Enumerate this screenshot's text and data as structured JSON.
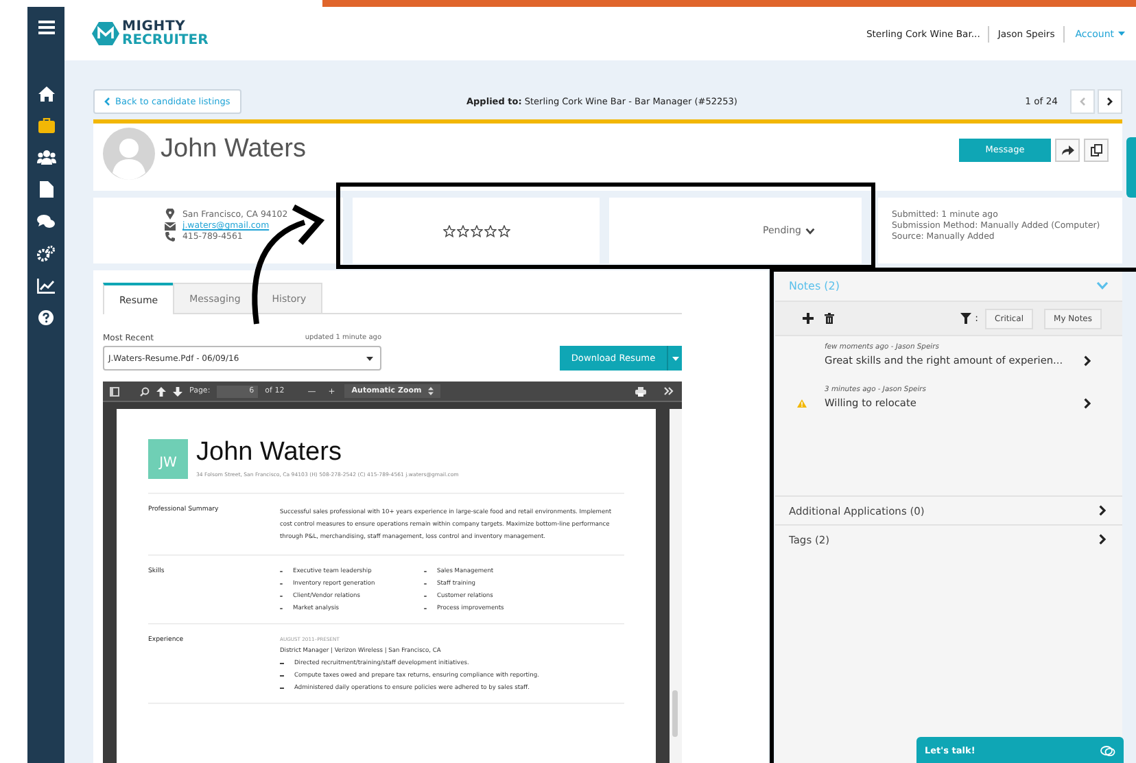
{
  "header": {
    "logo_top": "MIGHTY",
    "logo_bottom": "RECRUITER",
    "company": "Sterling Cork Wine Bar...",
    "user": "Jason Speirs",
    "account": "Account"
  },
  "sidebar": {
    "items": [
      {
        "kind": "home",
        "selected": false
      },
      {
        "kind": "briefcase",
        "selected": true
      },
      {
        "kind": "people",
        "selected": false
      },
      {
        "kind": "document",
        "selected": false
      },
      {
        "kind": "chat",
        "selected": false
      },
      {
        "kind": "settings",
        "selected": false
      },
      {
        "kind": "chart",
        "selected": false
      },
      {
        "kind": "help",
        "selected": false
      }
    ]
  },
  "nav": {
    "back": "Back to candidate listings",
    "applied_label": "Applied to:",
    "applied_value": "Sterling Cork Wine Bar - Bar Manager (#52253)",
    "position": "1 of 24"
  },
  "candidate": {
    "name": "John Waters",
    "message_button": "Message",
    "location": "San Francisco, CA 94102",
    "email": "j.waters@gmail.com",
    "phone": "415-789-4561",
    "stars": 0,
    "status": "Pending",
    "submission": [
      "Submitted: 1 minute ago",
      "Submission Method: Manually Added (Computer)",
      "Source: Manually Added"
    ]
  },
  "tabs": [
    {
      "label": "Resume",
      "selected": true
    },
    {
      "label": "Messaging",
      "selected": false
    },
    {
      "label": "History",
      "selected": false
    }
  ],
  "resume": {
    "version_label": "Most Recent",
    "updated": "updated 1 minute ago",
    "file": "J.Waters-Resume.Pdf - 06/09/16",
    "download_button": "Download Resume"
  },
  "pdf_viewer": {
    "page_label": "Page:",
    "page": "6",
    "page_count": "of 12",
    "zoom_out": "—",
    "zoom_in": "+",
    "zoom": "Automatic Zoom"
  },
  "document": {
    "initials": "JW",
    "name": "John Waters",
    "contact": "34 Folsom Street, San Francisco, Ca 94103   (H) 508-278-2542   (C) 415-789-4561 j.waters@gmail.com",
    "sections": [
      {
        "kind": "paragraph",
        "heading": "Professional Summary",
        "text": "Successful sales professional with 10+ years experience in large-scale food and retail environments. Implement cost control measures to ensure operations remain within company targets. Maximize bottom-line performance through P&L, merchandising, staff management, loss control and inventory management."
      },
      {
        "kind": "columns",
        "heading": "Skills",
        "columns": [
          [
            "Executive team leadership",
            "Inventory report generation",
            "Client/Vendor relations",
            "Market analysis"
          ],
          [
            "Sales Management",
            "Staff training",
            "Customer relations",
            "Process improvements"
          ]
        ]
      },
      {
        "kind": "job",
        "heading": "Experience",
        "dates": "AUGUST 2011–PRESENT",
        "role": "District Manager  |  Verizon Wireless  |  San Francisco, CA",
        "bullets": [
          "Directed recruitment/training/staff development initiatives.",
          "Compute taxes owed and prepare tax returns, ensuring compliance with reporting.",
          "Administered daily operations to ensure policies were adhered to by sales staff."
        ]
      }
    ]
  },
  "notes": {
    "title": "Notes (2)",
    "filter_separator": ":",
    "filters": [
      "Critical",
      "My Notes"
    ],
    "items": [
      {
        "meta": "few moments ago - Jason Speirs",
        "text": "Great skills and the right amount of experien...",
        "critical": false
      },
      {
        "meta": "3 minutes ago - Jason Speirs",
        "text": "Willing to relocate",
        "critical": true
      }
    ]
  },
  "sections": [
    {
      "label": "Additional Applications (0)"
    },
    {
      "label": "Tags (2)"
    }
  ],
  "chat": {
    "label": "Let's talk!"
  }
}
